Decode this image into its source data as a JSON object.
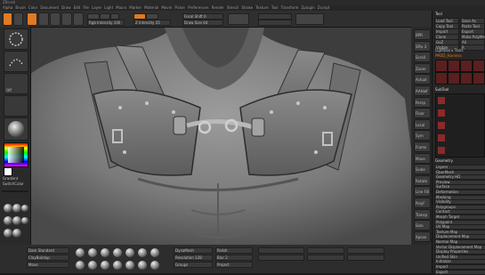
{
  "window": {
    "title": "ZBrush"
  },
  "menu": {
    "items": [
      "Alpha",
      "Brush",
      "Color",
      "Document",
      "Draw",
      "Edit",
      "File",
      "Layer",
      "Light",
      "Macro",
      "Marker",
      "Material",
      "Movie",
      "Picker",
      "Preferences",
      "Render",
      "Stencil",
      "Stroke",
      "Texture",
      "Tool",
      "Transform",
      "Zplugin",
      "Zscript"
    ]
  },
  "top_shelf": {
    "z_intensity": "Z Intensity 25",
    "draw_size": "Draw Size 64",
    "focal_shift": "Focal Shift 0",
    "rgb_intensity": "Rgb Intensity 100",
    "mode_labels": [
      "Edit",
      "Draw",
      "Move",
      "Scale",
      "Rotate"
    ],
    "toggles": [
      "Mrgb",
      "Rgb",
      "M",
      "Zadd",
      "Zsub"
    ]
  },
  "left_tray": {
    "brush": "ClayBuildup",
    "stroke": "DragRect",
    "alpha": "Off",
    "material": "MatCap Gray",
    "color_label": "SwitchColor",
    "gradient": "Gradient"
  },
  "bottom_shelf": {
    "items": [
      "Dam Standard",
      "ClayBuildup",
      "Move",
      "Standard",
      "Inflat",
      "hPolish",
      "Pinch",
      "TrimDynamic",
      "Smooth"
    ],
    "dynamesh": "DynaMesh",
    "resolution": "Resolution 128",
    "groups_label": "Groups",
    "polish": "Polish",
    "blur": "Blur 2",
    "project": "Project"
  },
  "right_tray": {
    "items": [
      "BPR",
      "SPix 3",
      "Scroll",
      "Zoom",
      "Actual",
      "AAHalf",
      "Persp",
      "Floor",
      "Local",
      "Sym",
      "Frame",
      "Move",
      "Scale",
      "Rotate",
      "Line Fill",
      "PolyF",
      "Transp",
      "Solo",
      "Xpose"
    ]
  },
  "palette": {
    "title": "Tool",
    "buttons": [
      "Load Tool",
      "Save As",
      "Copy Tool",
      "Paste Tool",
      "Import",
      "Export",
      "Clone",
      "Make PolyMesh3D",
      "GoZ",
      "All",
      "Visible",
      "R"
    ],
    "lightbox": "Lightbox ▸ Tools",
    "current_tool": "PM3D_Harness",
    "subtool": "SubTool",
    "geometry": "Geometry",
    "sections": [
      "Layers",
      "FiberMesh",
      "Geometry HD",
      "Preview",
      "Surface",
      "Deformation",
      "Masking",
      "Visibility",
      "Polygroups",
      "Contact",
      "Morph Target",
      "Polypaint",
      "UV Map",
      "Texture Map",
      "Displacement Map",
      "Normal Map",
      "Vector Displacement Map",
      "Display Properties",
      "Unified Skin",
      "Initialize",
      "Import",
      "Export"
    ]
  },
  "colors": {
    "accent": "#e07a23",
    "canvas": "#3c3c3c",
    "ui": "#2a2a2a"
  }
}
